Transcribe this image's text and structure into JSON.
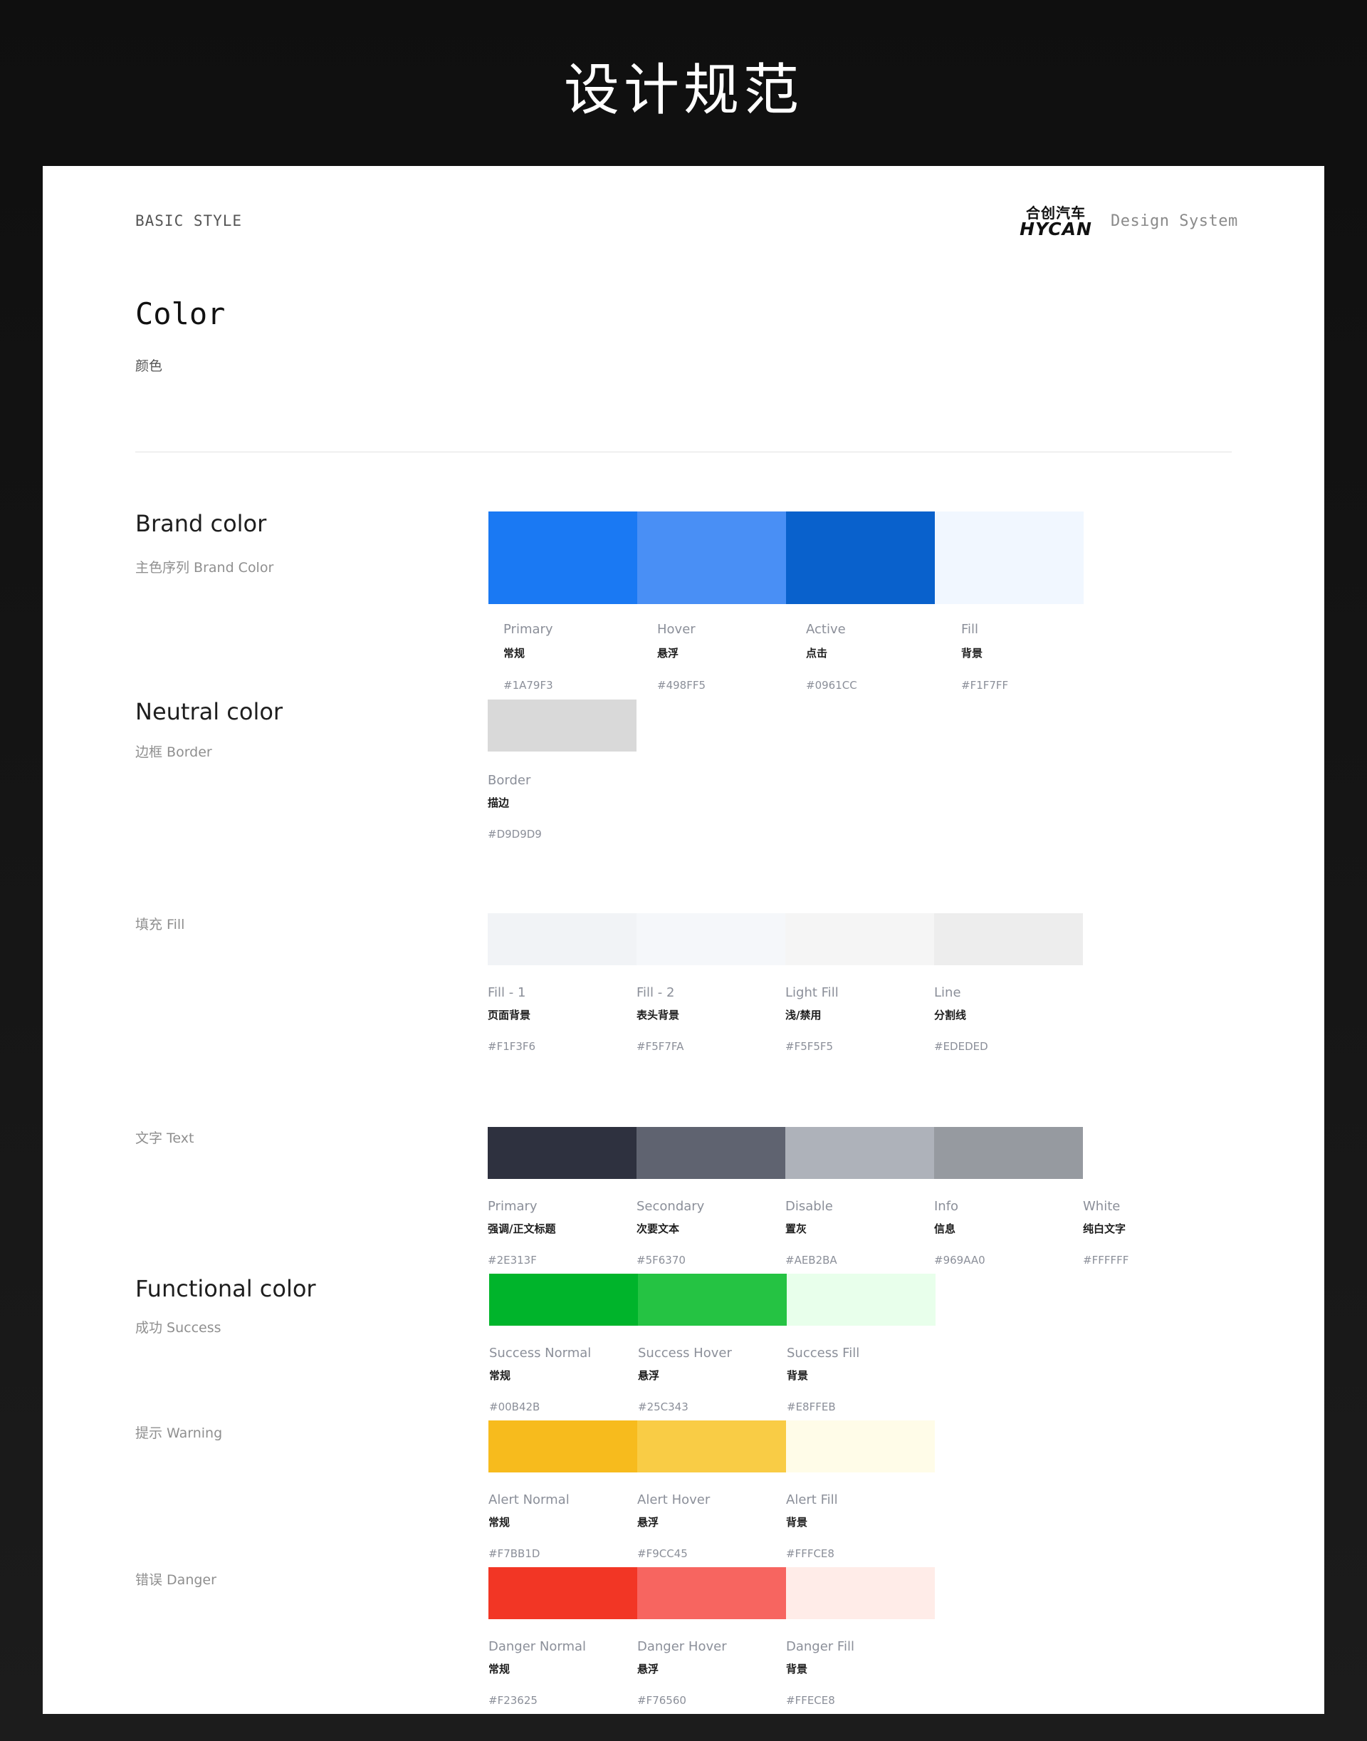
{
  "page_title": "设计规范",
  "header": {
    "basic_style": "BASIC STYLE",
    "logo_cn": "合创汽车",
    "logo_en": "HYCAN",
    "design_system": "Design System"
  },
  "intro": {
    "title": "Color",
    "subtitle": "颜色"
  },
  "sections": {
    "brand": {
      "title": "Brand color",
      "subtitle": "主色序列 Brand Color"
    },
    "neutral": {
      "title": "Neutral color",
      "subtitle": "边框 Border"
    },
    "fill": {
      "subtitle": "填充 Fill"
    },
    "text": {
      "subtitle": "文字 Text"
    },
    "functional": {
      "title": "Functional color",
      "subtitle": "成功 Success"
    },
    "warning": {
      "subtitle": "提示 Warning"
    },
    "danger": {
      "subtitle": "错误 Danger"
    }
  },
  "groups": {
    "brand": [
      {
        "en": "Primary",
        "cn": "常规",
        "hex": "#1A79F3",
        "color": "#1A79F3"
      },
      {
        "en": "Hover",
        "cn": "悬浮",
        "hex": "#498FF5",
        "color": "#498FF5"
      },
      {
        "en": "Active",
        "cn": "点击",
        "hex": "#0961CC",
        "color": "#0961CC"
      },
      {
        "en": "Fill",
        "cn": "背景",
        "hex": "#F1F7FF",
        "color": "#F1F7FF"
      }
    ],
    "border": [
      {
        "en": "Border",
        "cn": "描边",
        "hex": "#D9D9D9",
        "color": "#D9D9D9"
      }
    ],
    "fill": [
      {
        "en": "Fill - 1",
        "cn": "页面背景",
        "hex": "#F1F3F6",
        "color": "#F1F3F6"
      },
      {
        "en": "Fill - 2",
        "cn": "表头背景",
        "hex": "#F5F7FA",
        "color": "#F5F7FA"
      },
      {
        "en": "Light Fill",
        "cn": "浅/禁用",
        "hex": "#F5F5F5",
        "color": "#F5F5F5"
      },
      {
        "en": "Line",
        "cn": "分割线",
        "hex": "#EDEDED",
        "color": "#EDEDED"
      }
    ],
    "text": [
      {
        "en": "Primary",
        "cn": "强调/正文标题",
        "hex": "#2E313F",
        "color": "#2E313F"
      },
      {
        "en": "Secondary",
        "cn": "次要文本",
        "hex": "#5F6370",
        "color": "#5F6370"
      },
      {
        "en": "Disable",
        "cn": "置灰",
        "hex": "#AEB2BA",
        "color": "#AEB2BA"
      },
      {
        "en": "Info",
        "cn": "信息",
        "hex": "#969AA0",
        "color": "#969AA0"
      },
      {
        "en": "White",
        "cn": "纯白文字",
        "hex": "#FFFFFF",
        "color": "#FFFFFF"
      }
    ],
    "success": [
      {
        "en": "Success Normal",
        "cn": "常规",
        "hex": "#00B42B",
        "color": "#00B42B"
      },
      {
        "en": "Success Hover",
        "cn": "悬浮",
        "hex": "#25C343",
        "color": "#25C343"
      },
      {
        "en": "Success Fill",
        "cn": "背景",
        "hex": "#E8FFEB",
        "color": "#E8FFEB"
      }
    ],
    "warning": [
      {
        "en": "Alert Normal",
        "cn": "常规",
        "hex": "#F7BB1D",
        "color": "#F7BB1D"
      },
      {
        "en": "Alert Hover",
        "cn": "悬浮",
        "hex": "#F9CC45",
        "color": "#F9CC45"
      },
      {
        "en": "Alert Fill",
        "cn": "背景",
        "hex": "#FFFCE8",
        "color": "#FFFCE8"
      }
    ],
    "danger": [
      {
        "en": "Danger Normal",
        "cn": "常规",
        "hex": "#F23625",
        "color": "#F23625"
      },
      {
        "en": "Danger Hover",
        "cn": "悬浮",
        "hex": "#F76560",
        "color": "#F76560"
      },
      {
        "en": "Danger Fill",
        "cn": "背景",
        "hex": "#FFECE8",
        "color": "#FFECE8"
      }
    ]
  }
}
